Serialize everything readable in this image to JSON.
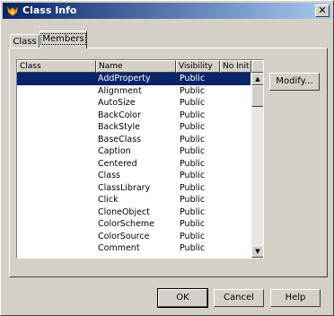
{
  "window": {
    "title": "Class Info",
    "close_glyph": "✕"
  },
  "tabs": [
    {
      "label": "Class"
    },
    {
      "label": "Members"
    }
  ],
  "list": {
    "columns": [
      "Class",
      "Name",
      "Visibility",
      "No Init"
    ],
    "rows": [
      {
        "class": "",
        "name": "AddProperty",
        "visibility": "Public",
        "noinit": ""
      },
      {
        "class": "",
        "name": "Alignment",
        "visibility": "Public",
        "noinit": ""
      },
      {
        "class": "",
        "name": "AutoSize",
        "visibility": "Public",
        "noinit": ""
      },
      {
        "class": "",
        "name": "BackColor",
        "visibility": "Public",
        "noinit": ""
      },
      {
        "class": "",
        "name": "BackStyle",
        "visibility": "Public",
        "noinit": ""
      },
      {
        "class": "",
        "name": "BaseClass",
        "visibility": "Public",
        "noinit": ""
      },
      {
        "class": "",
        "name": "Caption",
        "visibility": "Public",
        "noinit": ""
      },
      {
        "class": "",
        "name": "Centered",
        "visibility": "Public",
        "noinit": ""
      },
      {
        "class": "",
        "name": "Class",
        "visibility": "Public",
        "noinit": ""
      },
      {
        "class": "",
        "name": "ClassLibrary",
        "visibility": "Public",
        "noinit": ""
      },
      {
        "class": "",
        "name": "Click",
        "visibility": "Public",
        "noinit": ""
      },
      {
        "class": "",
        "name": "CloneObject",
        "visibility": "Public",
        "noinit": ""
      },
      {
        "class": "",
        "name": "ColorScheme",
        "visibility": "Public",
        "noinit": ""
      },
      {
        "class": "",
        "name": "ColorSource",
        "visibility": "Public",
        "noinit": ""
      },
      {
        "class": "",
        "name": "Comment",
        "visibility": "Public",
        "noinit": ""
      }
    ],
    "selected_index": 0
  },
  "buttons": {
    "modify": "Modify...",
    "ok": "OK",
    "cancel": "Cancel",
    "help": "Help"
  },
  "colors": {
    "title_gradient_start": "#0a246a",
    "title_gradient_end": "#a6caf0",
    "selection": "#0a246a",
    "face": "#d4d0c8"
  },
  "icons": {
    "app": "fox-icon",
    "scroll_up": "up-arrow-icon",
    "scroll_down": "down-arrow-icon"
  }
}
